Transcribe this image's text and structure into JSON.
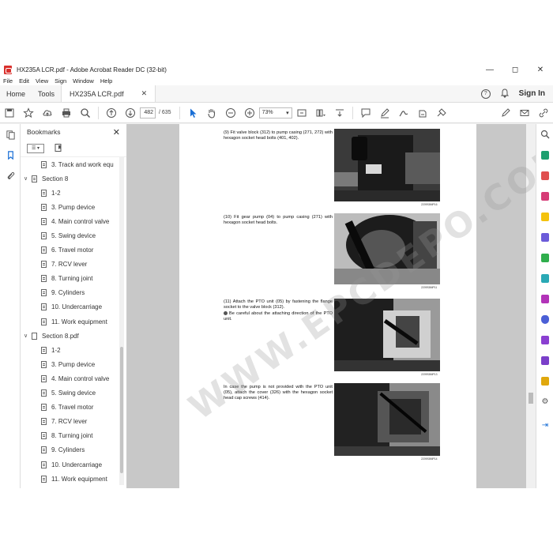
{
  "window": {
    "title": "HX235A LCR.pdf - Adobe Acrobat Reader DC (32-bit)"
  },
  "menu": [
    "File",
    "Edit",
    "View",
    "Sign",
    "Window",
    "Help"
  ],
  "tabs": {
    "home": "Home",
    "tools": "Tools",
    "document": "HX235A LCR.pdf",
    "sign_in": "Sign In"
  },
  "toolbar": {
    "current_page": "482",
    "page_total": "/ 635",
    "zoom": "73%"
  },
  "bookmarks": {
    "title": "Bookmarks",
    "items": [
      {
        "label": "3. Track and work equ",
        "level": 2,
        "expandable": false
      },
      {
        "label": "Section 8",
        "level": 1,
        "expandable": true
      },
      {
        "label": "1-2",
        "level": 2
      },
      {
        "label": "3. Pump device",
        "level": 2
      },
      {
        "label": "4. Main control valve",
        "level": 2
      },
      {
        "label": "5. Swing device",
        "level": 2
      },
      {
        "label": "6. Travel motor",
        "level": 2
      },
      {
        "label": "7. RCV lever",
        "level": 2
      },
      {
        "label": "8. Turning joint",
        "level": 2
      },
      {
        "label": "9. Cylinders",
        "level": 2
      },
      {
        "label": "10. Undercarriage",
        "level": 2
      },
      {
        "label": "11. Work equipment",
        "level": 2
      },
      {
        "label": "Section 8.pdf",
        "level": 1,
        "expandable": true
      },
      {
        "label": "1-2",
        "level": 2
      },
      {
        "label": "3. Pump device",
        "level": 2
      },
      {
        "label": "4. Main control valve",
        "level": 2
      },
      {
        "label": "5. Swing device",
        "level": 2
      },
      {
        "label": "6. Travel motor",
        "level": 2
      },
      {
        "label": "7. RCV lever",
        "level": 2
      },
      {
        "label": "8. Turning joint",
        "level": 2
      },
      {
        "label": "9. Cylinders",
        "level": 2
      },
      {
        "label": "10. Undercarriage",
        "level": 2
      },
      {
        "label": "11. Work equipment",
        "level": 2
      }
    ]
  },
  "document": {
    "steps": [
      {
        "text": "(9)  Fit valve block (312) to pump casing (271, 272) with hexagon socket head bolts (401, 402).",
        "caption": "2209S8MP16"
      },
      {
        "text": "(10) Fit gear pump (04) to pump casing (271) with hexagon socket head bolts.",
        "caption": "2209S8MP11"
      },
      {
        "text": "(11) Attach the PTO unit (05) by fastening the flange socket to the valve block (312).",
        "note": "Be careful about the attaching direction of the PTO unit.",
        "caption": "2209S8MP13"
      },
      {
        "text": "In case the pump is not provided with the PTO unit (05), attach the cover (326) with the hexagon socket head cap screws (414).",
        "caption": "2209S8MP14"
      }
    ],
    "watermark": "WWW.EPCDEPO.COM"
  }
}
